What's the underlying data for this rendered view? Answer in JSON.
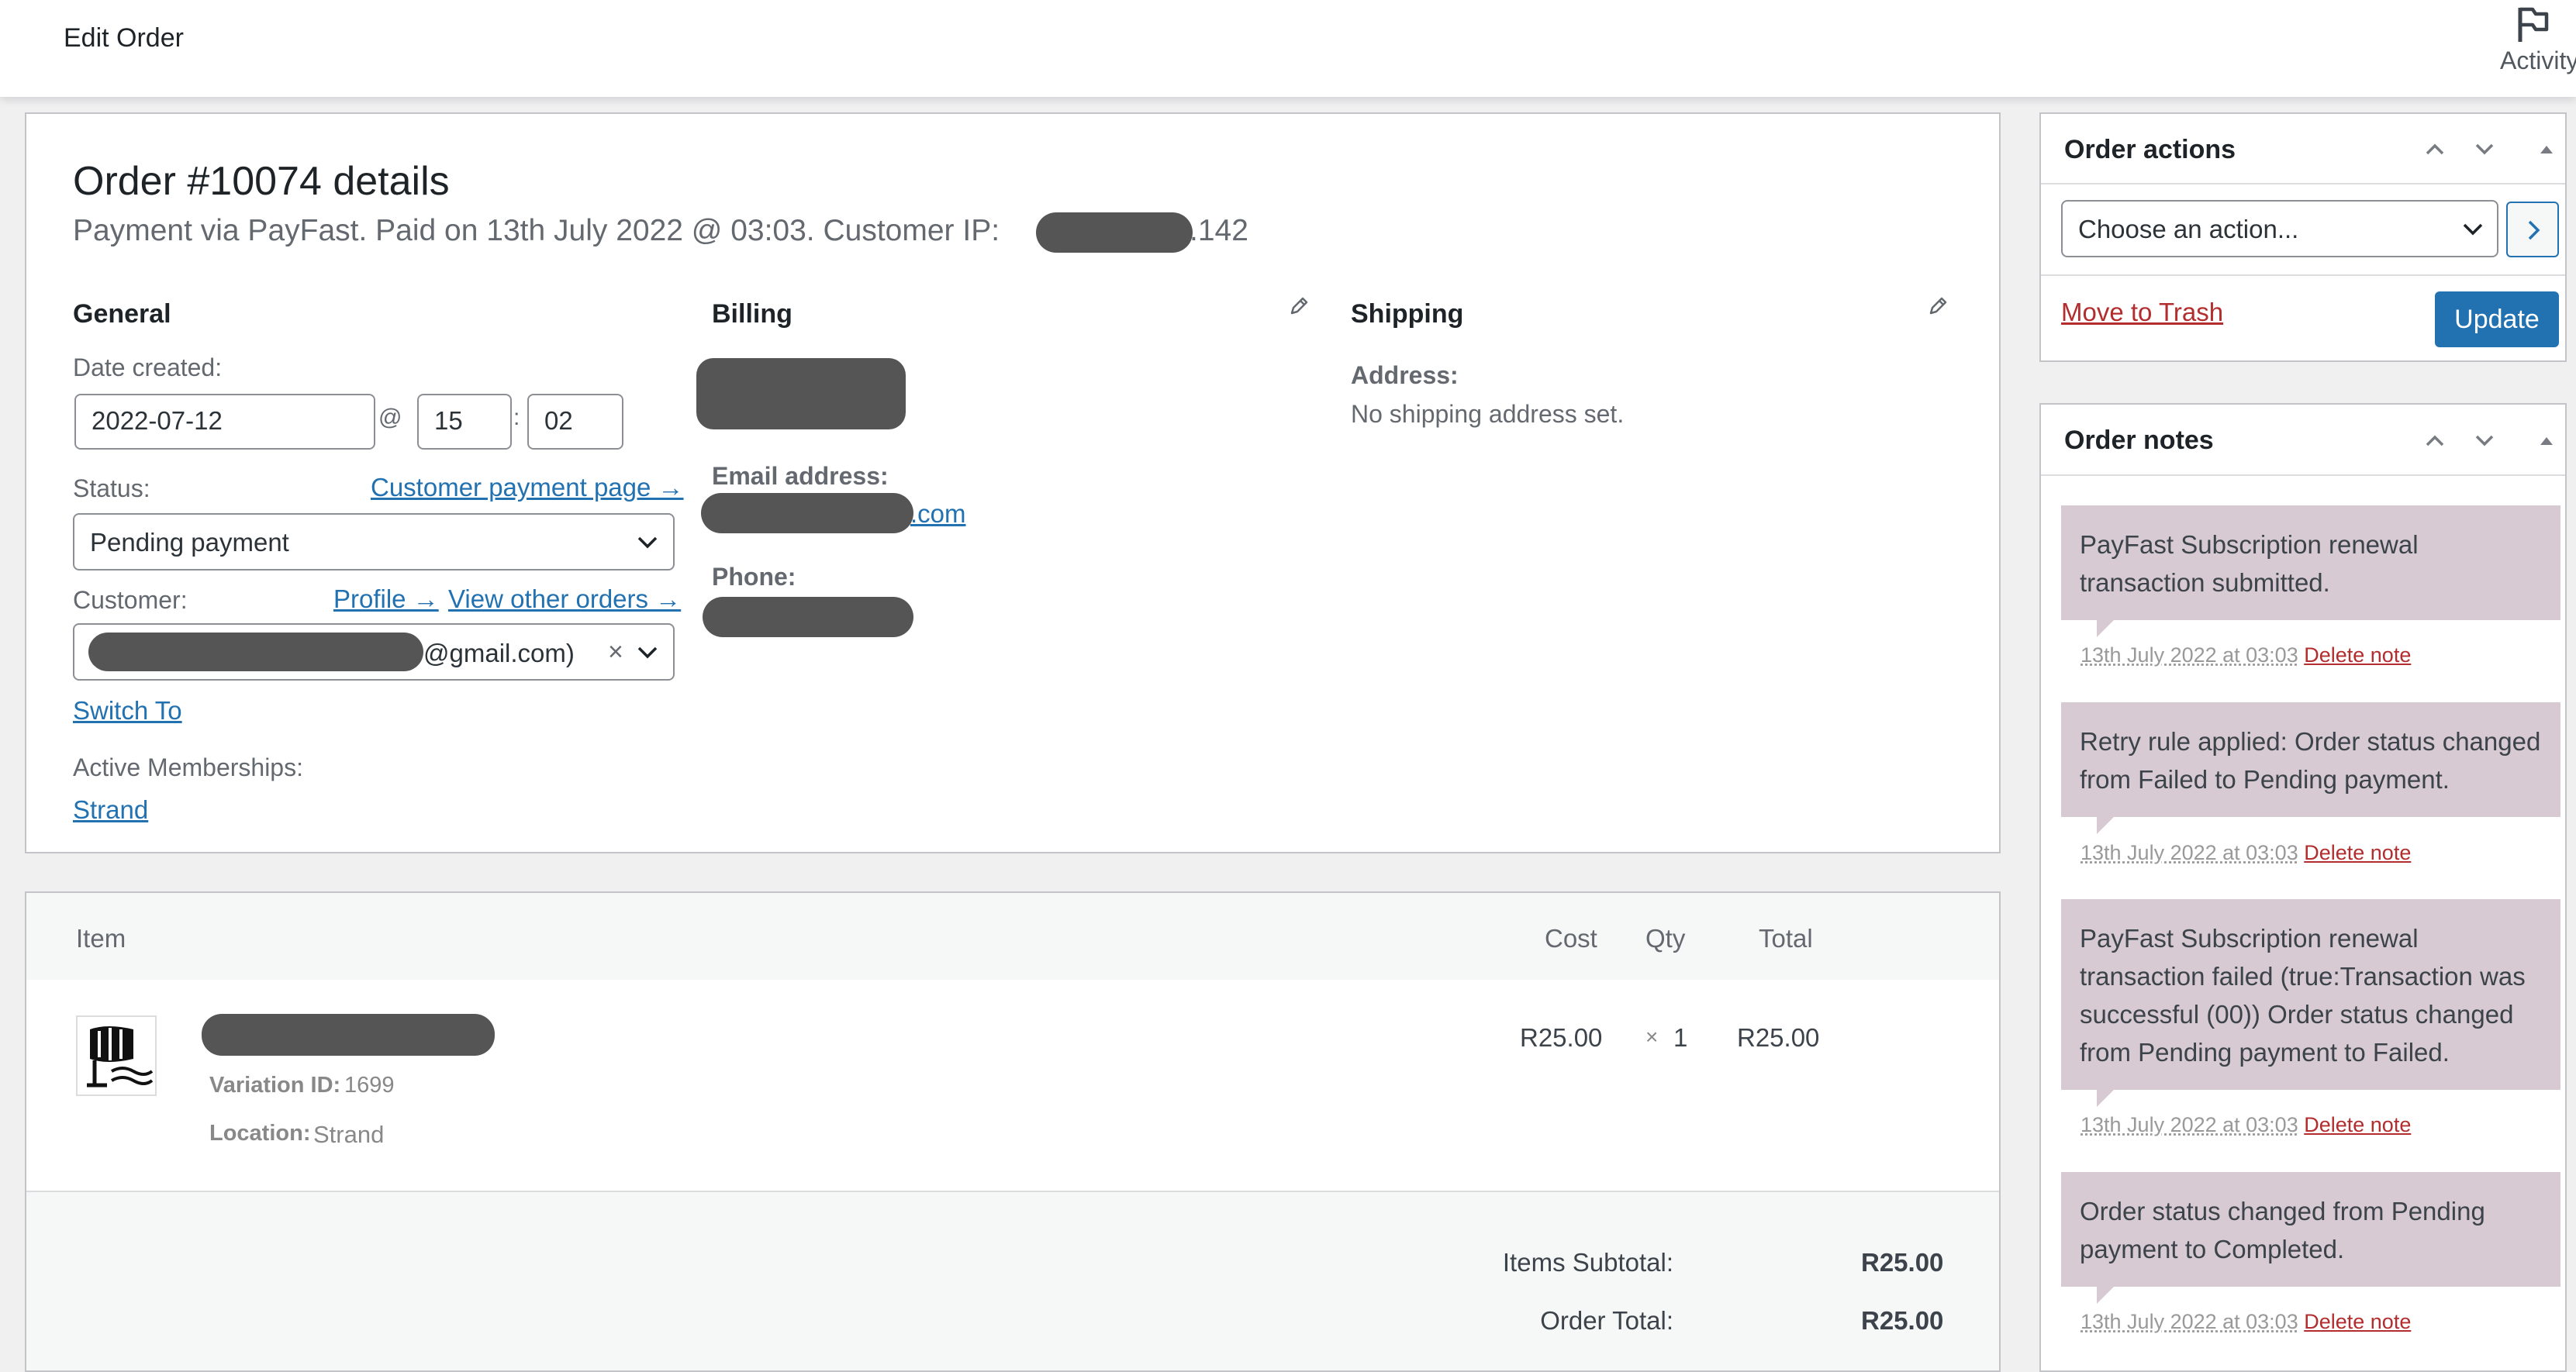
{
  "header": {
    "title": "Edit Order",
    "activity_label": "Activity"
  },
  "order": {
    "heading": "Order #10074 details",
    "payment_prefix": "Payment via PayFast. Paid on 13th July 2022 @ 03:03. Customer IP:",
    "ip_suffix": ".142"
  },
  "general": {
    "heading": "General",
    "date_created_label": "Date created:",
    "date": "2022-07-12",
    "at": "@",
    "hour": "15",
    "colon": ":",
    "minute": "02",
    "status_label": "Status:",
    "customer_payment_link": "Customer payment page →",
    "status_value": "Pending payment",
    "customer_label": "Customer:",
    "profile_link": "Profile →",
    "view_orders_link": "View other orders →",
    "customer_suffix": "@gmail.com)",
    "clear_symbol": "×",
    "switch_to_link": "Switch To",
    "memberships_label": "Active Memberships:",
    "membership_link": "Strand"
  },
  "billing": {
    "heading": "Billing",
    "email_label": "Email address:",
    "email_suffix": ".com",
    "phone_label": "Phone:"
  },
  "shipping": {
    "heading": "Shipping",
    "address_label": "Address:",
    "address_value": "No shipping address set."
  },
  "items": {
    "columns": {
      "item": "Item",
      "cost": "Cost",
      "qty": "Qty",
      "total": "Total"
    },
    "rows": [
      {
        "variation_label": "Variation ID:",
        "variation_id": "1699",
        "location_label": "Location:",
        "location": "Strand",
        "cost": "R25.00",
        "qty_prefix": "×",
        "qty": "1",
        "total": "R25.00"
      }
    ],
    "subtotal_label": "Items Subtotal:",
    "subtotal_value": "R25.00",
    "order_total_label": "Order Total:",
    "order_total_value": "R25.00"
  },
  "order_actions": {
    "title": "Order actions",
    "select_value": "Choose an action...",
    "trash_link": "Move to Trash",
    "update_button": "Update"
  },
  "order_notes": {
    "title": "Order notes",
    "notes": [
      {
        "text": "PayFast Subscription renewal transaction submitted.",
        "date": "13th July 2022 at 03:03",
        "delete": "Delete note"
      },
      {
        "text": "Retry rule applied: Order status changed from Failed to Pending payment.",
        "date": "13th July 2022 at 03:03",
        "delete": "Delete note"
      },
      {
        "text": "PayFast Subscription renewal transaction failed (true:Transaction was successful (00)) Order status changed from Pending payment to Failed.",
        "date": "13th July 2022 at 03:03",
        "delete": "Delete note"
      },
      {
        "text": "Order status changed from Pending payment to Completed.",
        "date": "13th July 2022 at 03:03",
        "delete": "Delete note"
      }
    ]
  },
  "colors": {
    "link": "#2271b1",
    "primary_button": "#2271b1",
    "note_background": "#d7cad2",
    "delete_link": "#b32d2e",
    "redaction": "#555555"
  }
}
